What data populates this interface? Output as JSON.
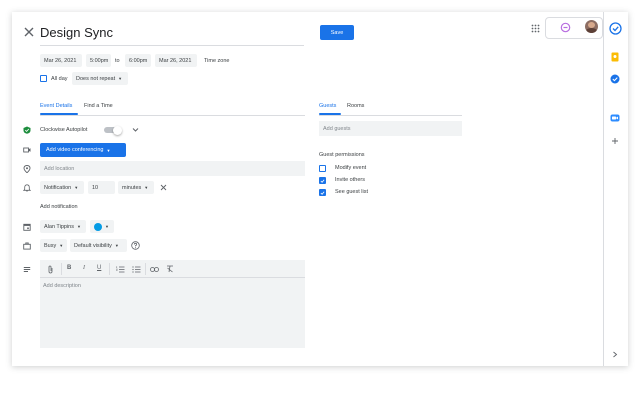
{
  "event": {
    "title": "Design Sync",
    "save_label": "Save",
    "start_date": "Mar 26, 2021",
    "start_time": "5:00pm",
    "to_label": "to",
    "end_time": "6:00pm",
    "end_date": "Mar 26, 2021",
    "timezone_label": "Time zone",
    "allday_label": "All day",
    "repeat_label": "Does not repeat"
  },
  "tabs": {
    "details": "Event Details",
    "find_time": "Find a Time",
    "guests": "Guests",
    "rooms": "Rooms"
  },
  "details": {
    "autopilot_label": "Clockwise Autopilot",
    "conferencing_label": "Add video conferencing",
    "location_placeholder": "Add location",
    "notification_type": "Notification",
    "notification_value": "10",
    "notification_unit": "minutes",
    "add_notification": "Add notification",
    "calendar_owner": "Alan Tippins",
    "calendar_color": "#039be5",
    "busy_label": "Busy",
    "visibility_label": "Default visibility",
    "description_placeholder": "Add description"
  },
  "guests": {
    "add_placeholder": "Add guests",
    "permissions_title": "Guest permissions",
    "permissions": [
      {
        "label": "Modify event",
        "checked": false
      },
      {
        "label": "Invite others",
        "checked": true
      },
      {
        "label": "See guest list",
        "checked": true
      }
    ]
  },
  "toolbar": {
    "icons": [
      "attach-icon",
      "bold-icon",
      "italic-icon",
      "underline-icon",
      "numbered-list-icon",
      "bulleted-list-icon",
      "link-icon",
      "clear-format-icon"
    ]
  },
  "colors": {
    "accent": "#1a73e8",
    "rail_yellow": "#fbbc04",
    "rail_blue": "#1a73e8"
  }
}
